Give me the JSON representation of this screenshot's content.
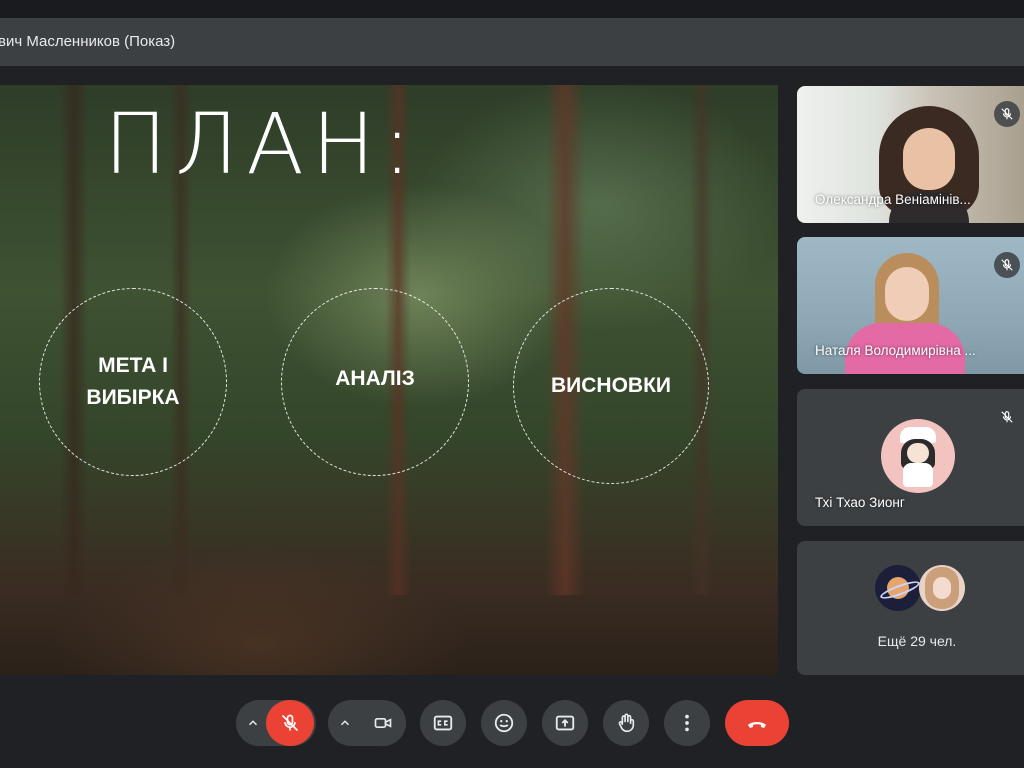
{
  "header": {
    "presenter_title": "вич Масленников (Показ)"
  },
  "slide": {
    "heading": "ПЛАН:",
    "items": [
      {
        "label": "МЕТА І ВИБІРКА"
      },
      {
        "label": "АНАЛІЗ"
      },
      {
        "label": "ВИСНОВКИ"
      }
    ]
  },
  "participants": [
    {
      "name": "Олександра Веніамінів...",
      "muted": true
    },
    {
      "name": "Наталя Володимирівна ...",
      "muted": true
    },
    {
      "name": "Тхі Тхао Зионг",
      "muted": true
    },
    {
      "name": "Ещё 29 чел."
    }
  ],
  "controls": {
    "mic": "muted",
    "items": [
      "mic-options",
      "mic",
      "camera-options",
      "camera",
      "captions",
      "reactions",
      "present",
      "raise-hand",
      "more-options",
      "leave-call"
    ]
  },
  "colors": {
    "accent_red": "#ea4335",
    "control_bg": "#3c4043",
    "tile_bg": "#3c4043",
    "page_bg": "#202124"
  }
}
